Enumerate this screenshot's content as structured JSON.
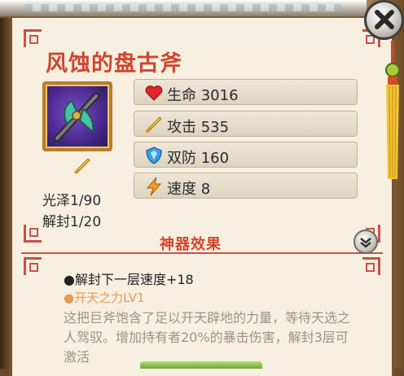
{
  "item": {
    "name": "风蚀的盘古斧",
    "luster": "光泽1/90",
    "unseal": "解封1/20"
  },
  "stats": [
    {
      "icon": "heart-icon",
      "label": "生命 3016"
    },
    {
      "icon": "sword-icon",
      "label": "攻击 535"
    },
    {
      "icon": "shield-icon",
      "label": "双防 160"
    },
    {
      "icon": "lightning-icon",
      "label": "速度 8"
    }
  ],
  "effects": {
    "title": "神器效果",
    "next_unseal": "●解封下一层速度+18",
    "skill_name": "●开天之力LV1",
    "description": "这把巨斧饱含了足以开天辟地的力量，等待天选之人驾驭。增加持有者20%的暴击伤害，解封3层可激活"
  },
  "colors": {
    "title": "#d0462f",
    "skill": "#e99a58",
    "description": "#9b9387",
    "panel": "#f7efe0",
    "border_accent": "#c8514a"
  }
}
